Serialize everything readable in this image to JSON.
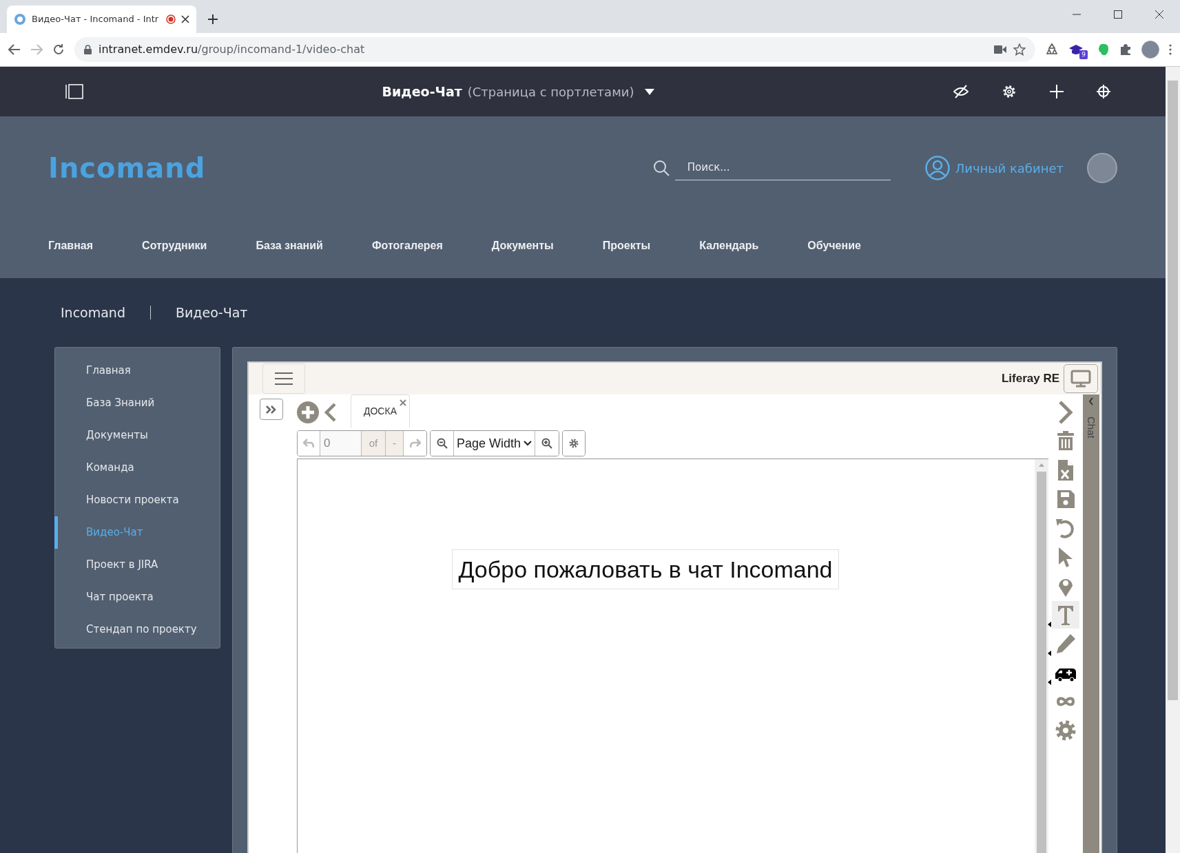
{
  "browser": {
    "tab_title": "Видео-Чат - Incomand - Intr",
    "recording": true,
    "url_host": "intranet.emdev.ru",
    "url_path": "/group/incomand-1/video-chat",
    "extension_badge": "9"
  },
  "top_bar": {
    "page_title": "Видео-Чат",
    "page_type": "(Страница с портлетами)"
  },
  "header": {
    "logo": "Incomand",
    "search": {
      "placeholder": "Поиск..."
    },
    "account_link": "Личный кабинет",
    "nav": [
      "Главная",
      "Сотрудники",
      "База знаний",
      "Фотогалерея",
      "Документы",
      "Проекты",
      "Календарь",
      "Обучение"
    ]
  },
  "breadcrumb": [
    "Incomand",
    "Видео-Чат"
  ],
  "sidebar": {
    "items": [
      {
        "label": "Главная",
        "selected": false
      },
      {
        "label": "База Знаний",
        "selected": false
      },
      {
        "label": "Документы",
        "selected": false
      },
      {
        "label": "Команда",
        "selected": false
      },
      {
        "label": "Новости проекта",
        "selected": false
      },
      {
        "label": "Видео-Чат",
        "selected": true
      },
      {
        "label": "Проект в JIRA",
        "selected": false
      },
      {
        "label": "Чат проекта",
        "selected": false
      },
      {
        "label": "Стендап по проекту",
        "selected": false
      }
    ]
  },
  "whiteboard": {
    "presenter": "Liferay RE",
    "tabs": [
      {
        "label": "ДОСКА",
        "selected": true
      }
    ],
    "pager": {
      "page": "0",
      "of": "of",
      "total": "-"
    },
    "zoom": "Page Width",
    "text": "Добро пожаловать в чат Incomand",
    "chat_label": "Chat",
    "tools": [
      {
        "kind": "next",
        "selected": false,
        "submenu": false
      },
      {
        "kind": "trash",
        "selected": false,
        "submenu": false
      },
      {
        "kind": "excel",
        "selected": false,
        "submenu": false
      },
      {
        "kind": "save",
        "selected": false,
        "submenu": false
      },
      {
        "kind": "undo",
        "selected": false,
        "submenu": false
      },
      {
        "kind": "pointer",
        "selected": false,
        "submenu": false
      },
      {
        "kind": "pin",
        "selected": false,
        "submenu": false
      },
      {
        "kind": "text",
        "selected": true,
        "submenu": true
      },
      {
        "kind": "pencil",
        "selected": false,
        "submenu": true
      },
      {
        "kind": "ambulance",
        "selected": false,
        "submenu": true
      },
      {
        "kind": "infinity",
        "selected": false,
        "submenu": false
      },
      {
        "kind": "settings",
        "selected": false,
        "submenu": false
      }
    ]
  }
}
